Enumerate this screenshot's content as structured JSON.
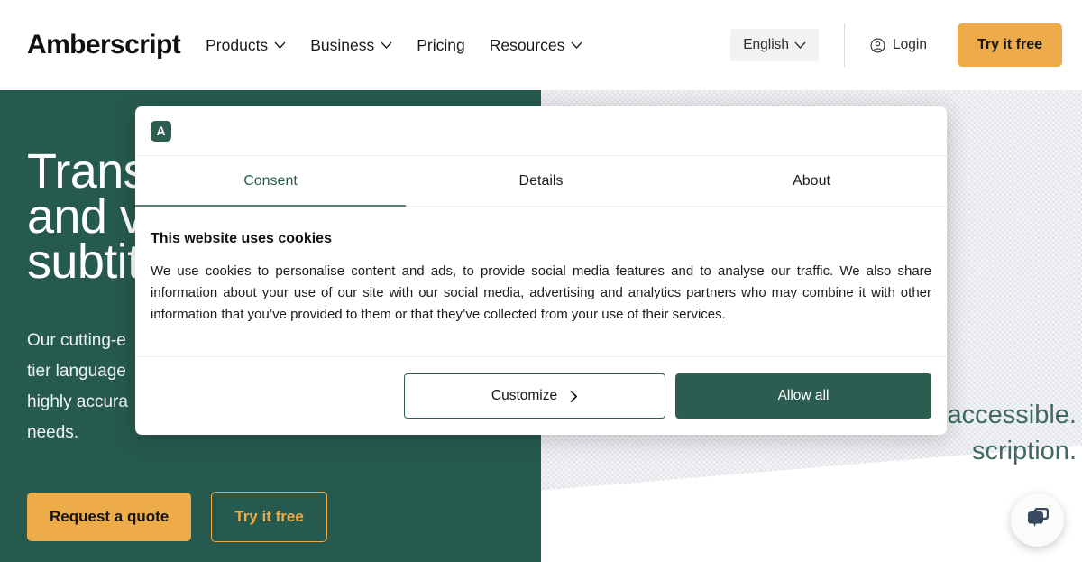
{
  "navbar": {
    "brand": "Amberscript",
    "links": [
      {
        "label": "Products",
        "has_chevron": true,
        "icon": "chevron-down-icon"
      },
      {
        "label": "Business",
        "has_chevron": true,
        "icon": "chevron-down-icon"
      },
      {
        "label": "Pricing",
        "has_chevron": false,
        "icon": ""
      },
      {
        "label": "Resources",
        "has_chevron": true,
        "icon": "chevron-down-icon"
      }
    ],
    "language": {
      "label": "English",
      "icon": "chevron-down-icon"
    },
    "login": {
      "label": "Login",
      "icon": "user-circle-icon"
    },
    "cta": {
      "label": "Try it free",
      "color": "#eeab4a"
    }
  },
  "hero": {
    "heading": "Trans\nand v\nsubtit",
    "paragraph": "Our cutting-e\ntier language\nhighly accura\nneeds.",
    "primary_button": "Request a quote",
    "secondary_button": "Try it free",
    "right_text": "accessible.\nscription.",
    "background_color": "#275a4e",
    "accent_color": "#eeab4a"
  },
  "chat": {
    "icon": "chat-bubbles-icon",
    "label": "Open chat"
  },
  "cookie_dialog": {
    "logo_letter": "A",
    "logo_name": "amberscript-logo-icon",
    "tabs": [
      {
        "label": "Consent",
        "active": true
      },
      {
        "label": "Details",
        "active": false
      },
      {
        "label": "About",
        "active": false
      }
    ],
    "title": "This website uses cookies",
    "text": "We use cookies to personalise content and ads, to provide social media features and to analyse our traffic. We also share information about your use of our site with our social media, advertising and analytics partners who may combine it with other information that you’ve provided to them or that they’ve collected from your use of their services.",
    "customize_button": "Customize",
    "customize_icon": "chevron-right-icon",
    "allow_button": "Allow all",
    "accent_color": "#2c5d50"
  }
}
